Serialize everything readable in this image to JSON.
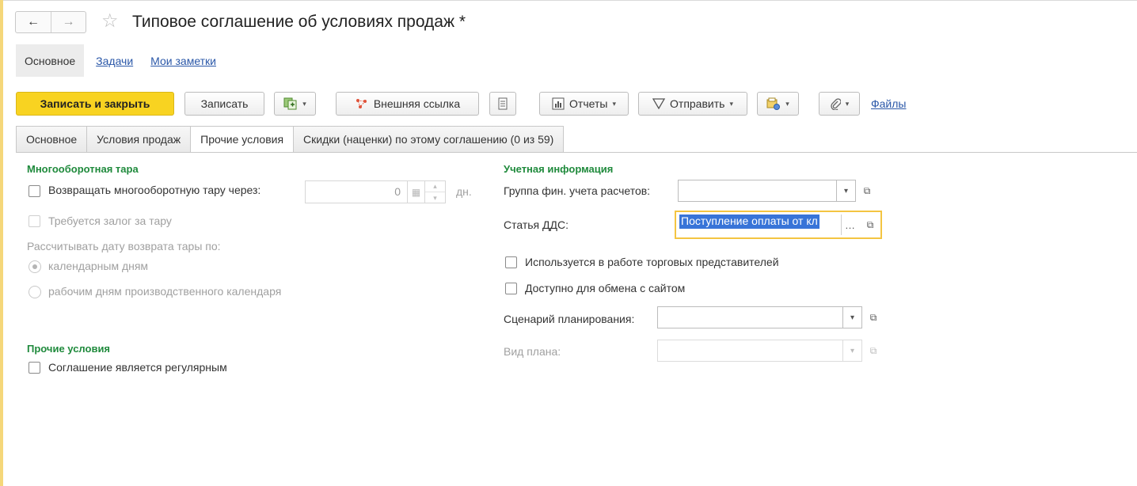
{
  "window": {
    "title": "Типовое соглашение об условиях продаж *",
    "back_icon": "←",
    "forward_icon": "→",
    "star_icon": "☆"
  },
  "sections": {
    "active": "Основное",
    "tasks": "Задачи",
    "notes": "Мои заметки"
  },
  "toolbar": {
    "save_close": "Записать и закрыть",
    "save": "Записать",
    "external_link": "Внешняя ссылка",
    "reports": "Отчеты",
    "send": "Отправить",
    "files": "Файлы",
    "caret": "▾",
    "accent": "#f8d321"
  },
  "tabs": [
    {
      "label": "Основное"
    },
    {
      "label": "Условия продаж"
    },
    {
      "label": "Прочие условия"
    },
    {
      "label": "Скидки (наценки) по этому соглашению (0 из 59)"
    }
  ],
  "left": {
    "returnable_title": "Многооборотная тара",
    "return_through_label": "Возвращать многооборотную тару через:",
    "return_days_value": "0",
    "days_unit": "дн.",
    "deposit_label": "Требуется залог за тару",
    "calc_date_label": "Рассчитывать дату возврата тары по:",
    "radio_calendar": "календарным дням",
    "radio_work": "рабочим дням производственного календаря",
    "other_title": "Прочие условия",
    "regular_label": "Соглашение является регулярным"
  },
  "right": {
    "accounting_title": "Учетная информация",
    "fin_group_label": "Группа фин. учета расчетов:",
    "fin_group_value": "",
    "dds_label": "Статья ДДС:",
    "dds_value": "Поступление оплаты от кл",
    "sales_reps_label": "Используется в работе торговых представителей",
    "site_exchange_label": "Доступно для обмена с сайтом",
    "scenario_label": "Сценарий планирования:",
    "scenario_value": "",
    "plan_type_label": "Вид плана:",
    "plan_type_value": ""
  }
}
